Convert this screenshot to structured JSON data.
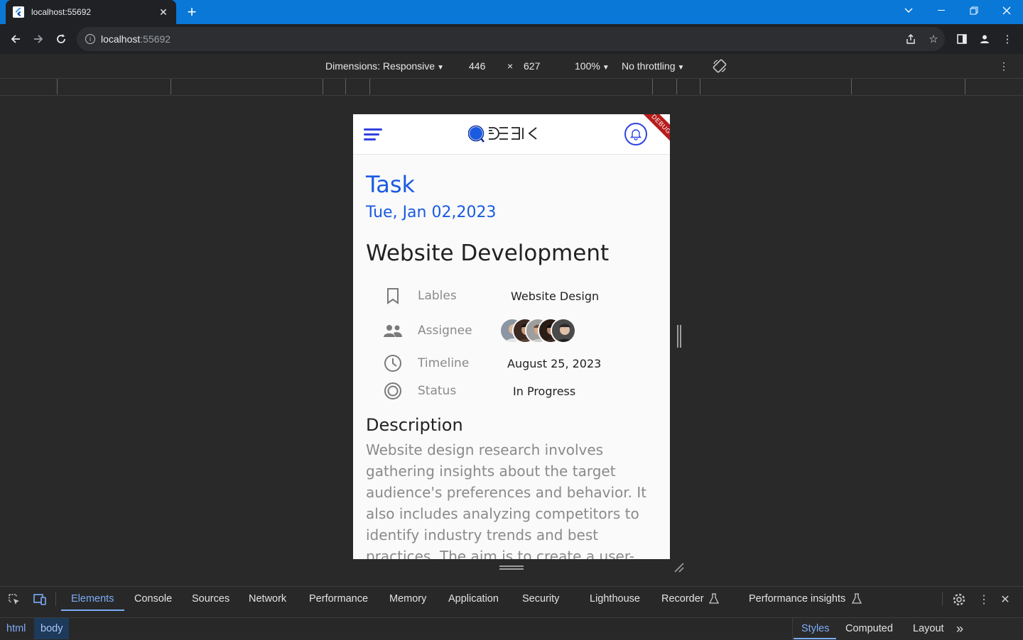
{
  "browser": {
    "tab_title": "localhost:55692",
    "new_tab_glyph": "+",
    "url_host": "localhost",
    "url_port": ":55692"
  },
  "device_toolbar": {
    "dimensions_label": "Dimensions: Responsive",
    "width": "446",
    "times": "×",
    "height": "627",
    "zoom": "100%",
    "throttling": "No throttling"
  },
  "app": {
    "debug_banner": "DEBUG",
    "page_title": "Task",
    "date": "Tue, Jan 02,2023",
    "project_title": "Website Development",
    "fields": [
      {
        "label": "Lables",
        "value": "Website Design",
        "icon": "bookmark-icon"
      },
      {
        "label": "Assignee",
        "value": "",
        "icon": "people-icon"
      },
      {
        "label": "Timeline",
        "value": "August 25, 2023",
        "icon": "clock-icon"
      },
      {
        "label": "Status",
        "value": "In Progress",
        "icon": "status-ring-icon"
      }
    ],
    "description_title": "Description",
    "description_body": "Website design research involves gathering insights about the target audience's preferences and behavior. It also includes analyzing competitors to identify industry trends and best practices. The aim is to create a user-"
  },
  "devtools": {
    "tabs": [
      "Elements",
      "Console",
      "Sources",
      "Network",
      "Performance",
      "Memory",
      "Application",
      "Security",
      "Lighthouse",
      "Recorder",
      "Performance insights"
    ],
    "breadcrumbs": [
      "html",
      "body"
    ],
    "side_tabs": [
      "Styles",
      "Computed",
      "Layout"
    ],
    "more_glyph": "»"
  },
  "colors": {
    "accent": "#1a5be0",
    "chrome_blue": "#0a78d6",
    "devtools_accent": "#7cacf8"
  }
}
